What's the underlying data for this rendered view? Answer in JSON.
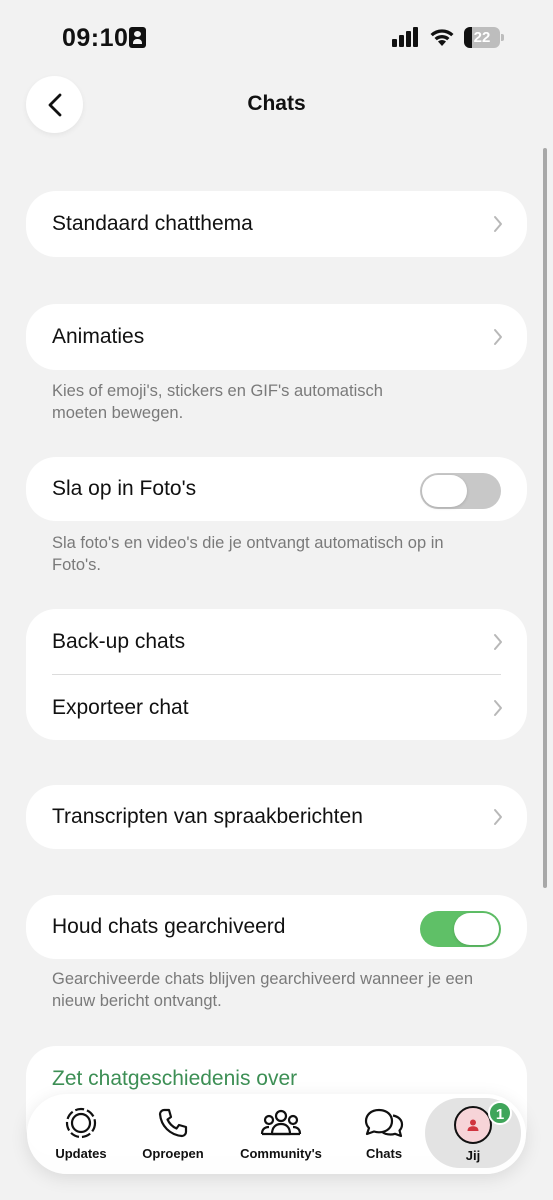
{
  "status_bar": {
    "time": "09:10",
    "battery": "22",
    "battery_level": 0.22
  },
  "header": {
    "title": "Chats"
  },
  "settings": {
    "default_chat_theme": "Standaard chatthema",
    "animations": "Animaties",
    "animations_note": "Kies of emoji's, stickers en GIF's automatisch moeten bewegen.",
    "save_to_photos": "Sla op in Foto's",
    "save_to_photos_on": false,
    "save_to_photos_note": "Sla foto's en video's die je ontvangt automatisch op in Foto's.",
    "backup_chats": "Back-up chats",
    "export_chat": "Exporteer chat",
    "voice_transcripts": "Transcripten van spraakberichten",
    "keep_archived": "Houd chats gearchiveerd",
    "keep_archived_on": true,
    "keep_archived_note": "Gearchiveerde chats blijven gearchiveerd wanneer je een nieuw bericht ontvangt.",
    "transfer_history": "Zet chatgeschiedenis over"
  },
  "tab_bar": {
    "updates": "Updates",
    "calls": "Oproepen",
    "communities": "Community's",
    "chats": "Chats",
    "you": "Jij",
    "you_badge": "1"
  },
  "colors": {
    "accent_green": "#5fc067",
    "link_green": "#3d8f55",
    "badge_green": "#3fa55a",
    "background": "#f2f2f2"
  }
}
